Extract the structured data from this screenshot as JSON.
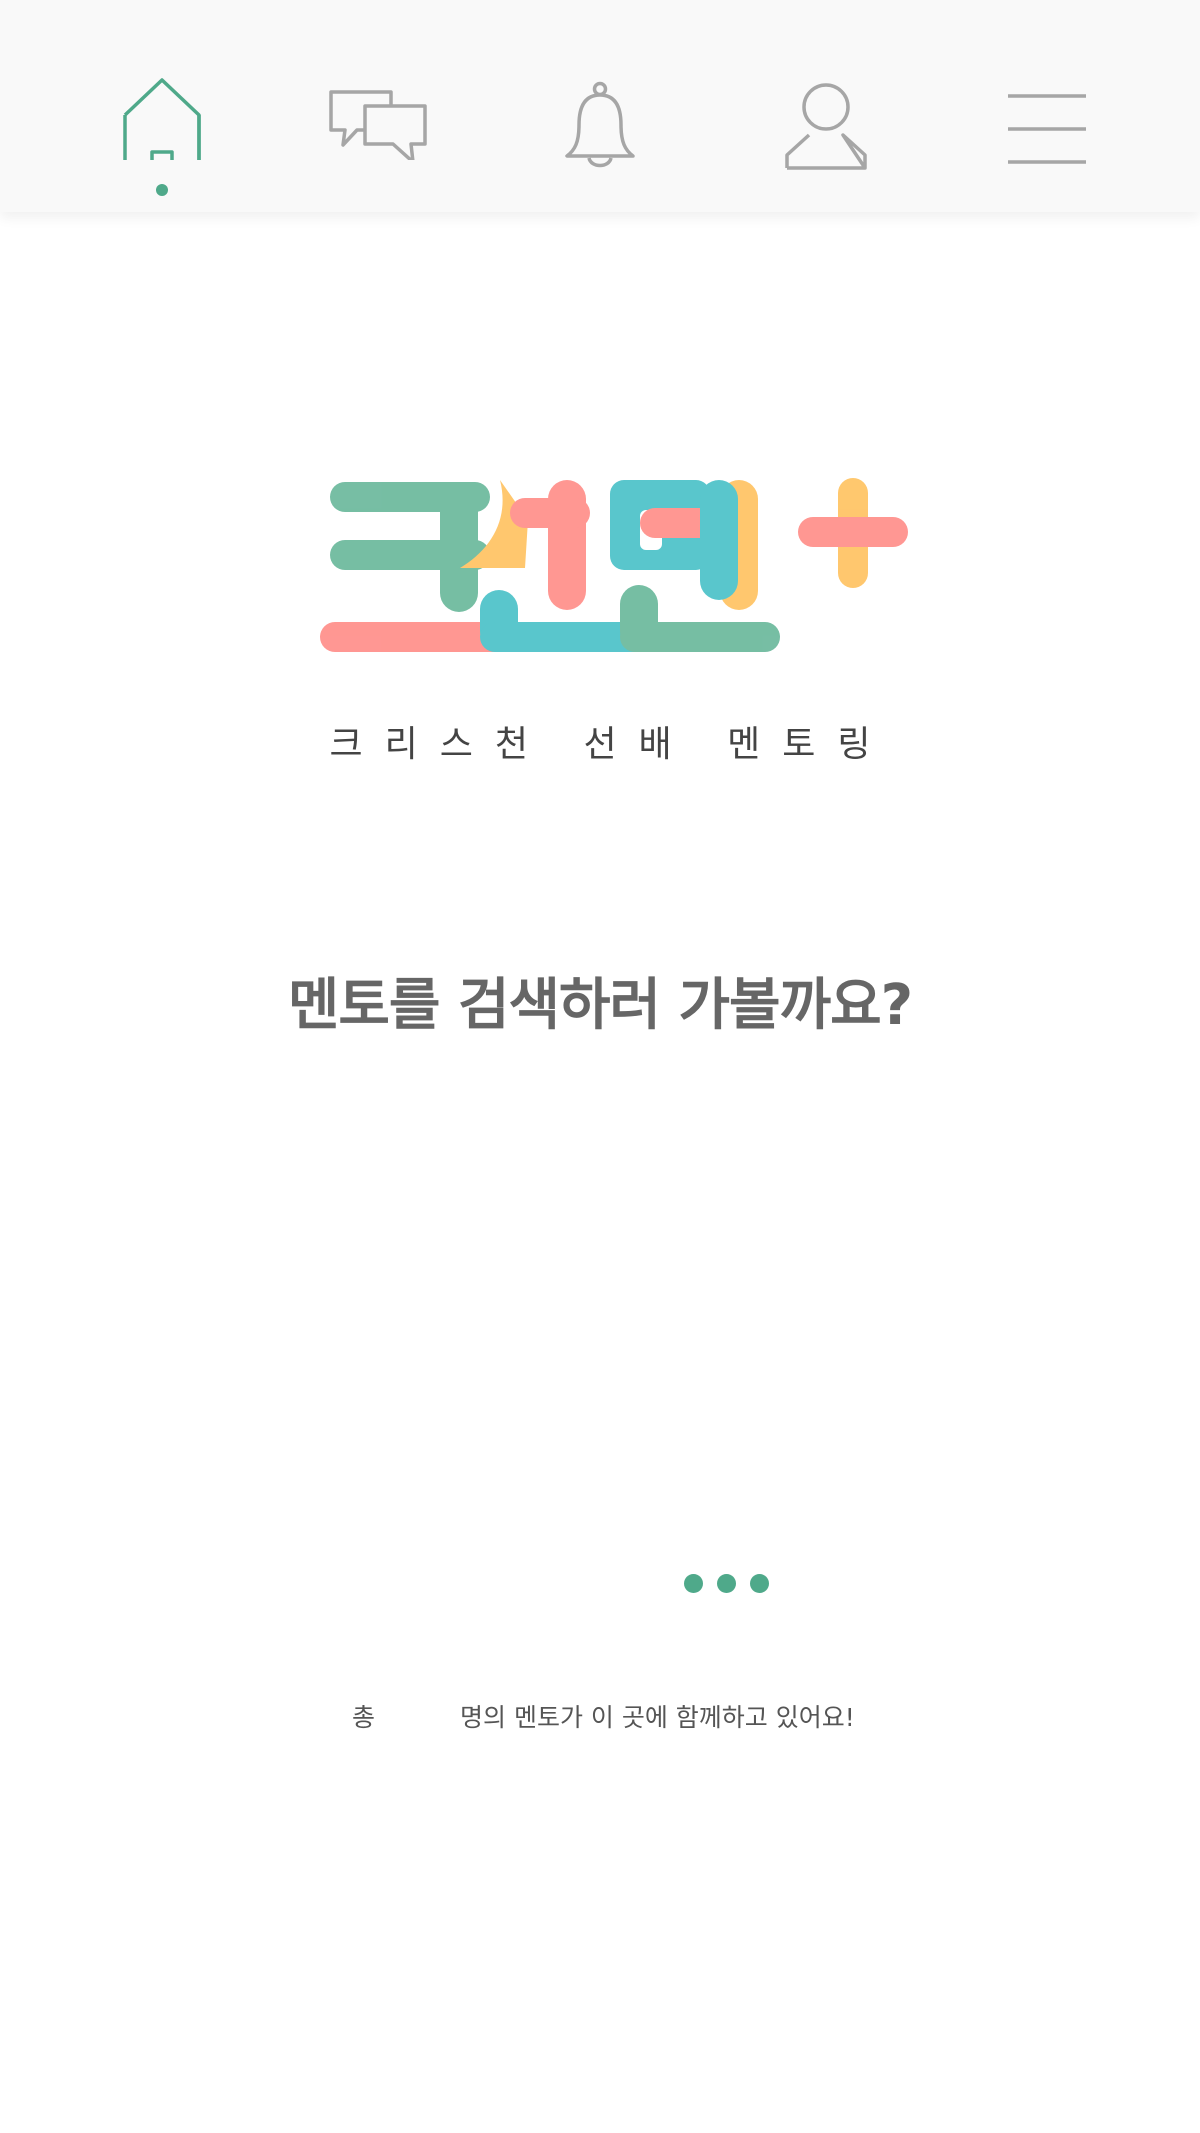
{
  "nav": {
    "items": [
      {
        "icon": "home-icon",
        "active": true
      },
      {
        "icon": "chat-icon",
        "active": false
      },
      {
        "icon": "bell-icon",
        "active": false
      },
      {
        "icon": "user-icon",
        "active": false
      },
      {
        "icon": "menu-icon",
        "active": false
      }
    ],
    "active_color": "#4fa98a",
    "inactive_color": "#a6a6a6"
  },
  "logo": {
    "text": "크선멘+",
    "colors": {
      "green": "#5fb394",
      "yellow": "#ffbe55",
      "coral": "#ff8580",
      "teal": "#3dbdc4"
    }
  },
  "tagline": "크리스천 선배 멘토링",
  "headline": "멘토를 검색하러 가볼까요?",
  "mentor_count": {
    "prefix": "총",
    "suffix": "명의 멘토가 이 곳에 함께하고 있어요!"
  }
}
